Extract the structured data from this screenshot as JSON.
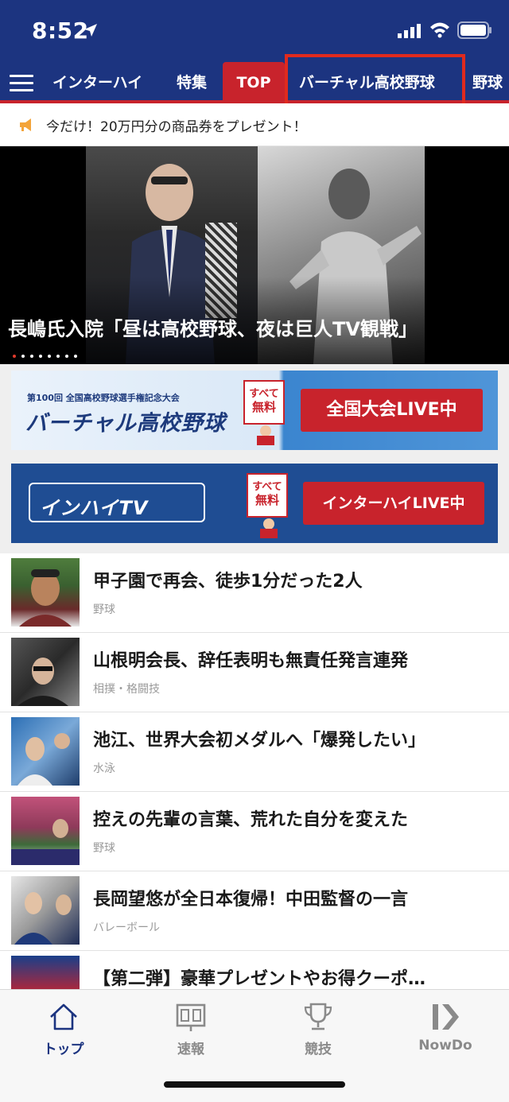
{
  "status_bar": {
    "time": "8:52"
  },
  "nav": {
    "tabs": [
      {
        "label": "インターハイ"
      },
      {
        "label": "特集"
      },
      {
        "label": "TOP"
      },
      {
        "label": "バーチャル高校野球"
      },
      {
        "label": "野球"
      }
    ],
    "active_tab": "TOP",
    "highlighted_tab": "バーチャル高校野球"
  },
  "notice": {
    "text": "今だけ！20万円分の商品券をプレゼント！"
  },
  "hero": {
    "title": "長嶋氏入院「昼は高校野球、夜は巨人TV観戦」",
    "slide_count": 8,
    "active_slide": 1
  },
  "banners": [
    {
      "subtitle": "第100回 全国高校野球選手権記念大会",
      "logo": "バーチャル高校野球",
      "badge_top": "すべて",
      "badge_bottom": "無料",
      "cta": "全国大会LIVE中"
    },
    {
      "logo": "インハイTV",
      "badge_top": "すべて",
      "badge_bottom": "無料",
      "cta": "インターハイLIVE中"
    }
  ],
  "articles": [
    {
      "title": "甲子園で再会、徒歩1分だった2人",
      "category": "野球"
    },
    {
      "title": "山根明会長、辞任表明も無責任発言連発",
      "category": "相撲・格闘技"
    },
    {
      "title": "池江、世界大会初メダルへ「爆発したい」",
      "category": "水泳"
    },
    {
      "title": "控えの先輩の言葉、荒れた自分を変えた",
      "category": "野球"
    },
    {
      "title": "長岡望悠が全日本復帰！中田監督の一言",
      "category": "バレーボール"
    },
    {
      "title": "【第二弾】豪華プレゼントやお得クーポ…",
      "category": ""
    }
  ],
  "bottom_nav": [
    {
      "label": "トップ",
      "icon": "home-icon",
      "active": true
    },
    {
      "label": "速報",
      "icon": "scoreboard-icon",
      "active": false
    },
    {
      "label": "競技",
      "icon": "trophy-icon",
      "active": false
    },
    {
      "label": "NowDo",
      "icon": "nowdo-icon",
      "active": false
    }
  ],
  "colors": {
    "header": "#1c3480",
    "accent": "#c8232c",
    "highlight_box": "#e02a1e"
  }
}
